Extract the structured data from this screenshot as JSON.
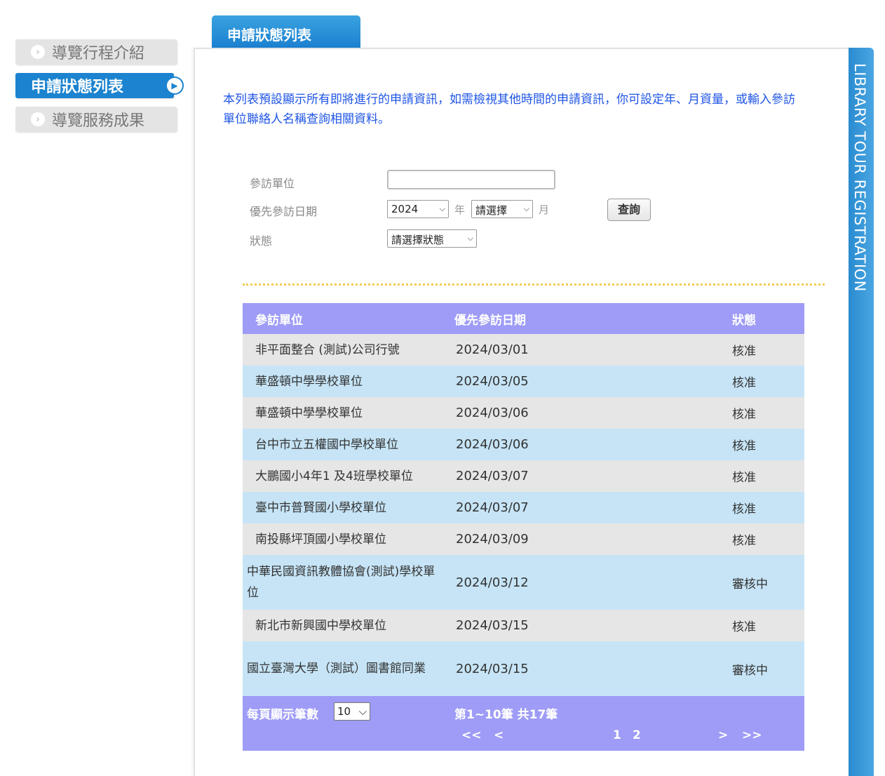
{
  "sidebar": {
    "items": [
      {
        "label": "導覽行程介紹",
        "active": false
      },
      {
        "label": "申請狀態列表",
        "active": true
      },
      {
        "label": "導覽服務成果",
        "active": false
      }
    ]
  },
  "tab": {
    "label": "申請狀態列表"
  },
  "vertical_banner": "LIBRARY TOUR REGISTRATION",
  "intro_text": "本列表預設顯示所有即將進行的申請資訊，如需檢視其他時間的申請資訊，你可設定年、月資量，或輸入參訪單位聯絡人名稱查詢相關資料。",
  "filters": {
    "unit_label": "參訪單位",
    "unit_value": "",
    "date_label": "優先參訪日期",
    "year_value": "2024",
    "year_unit": "年",
    "month_value": "請選擇",
    "month_unit": "月",
    "status_label": "狀態",
    "status_value": "請選擇狀態",
    "search_button": "查詢"
  },
  "table": {
    "headers": [
      "參訪單位",
      "優先參訪日期",
      "狀態"
    ],
    "rows": [
      {
        "unit": "非平面整合 (測試)公司行號",
        "date": "2024/03/01",
        "status": "核准"
      },
      {
        "unit": "華盛頓中學學校單位",
        "date": "2024/03/05",
        "status": "核准"
      },
      {
        "unit": "華盛頓中學學校單位",
        "date": "2024/03/06",
        "status": "核准"
      },
      {
        "unit": "台中市立五權國中學校單位",
        "date": "2024/03/06",
        "status": "核准"
      },
      {
        "unit": "大鵬國小4年1 及4班學校單位",
        "date": "2024/03/07",
        "status": "核准"
      },
      {
        "unit": "臺中市普賢國小學校單位",
        "date": "2024/03/07",
        "status": "核准"
      },
      {
        "unit": "南投縣坪頂國小學校單位",
        "date": "2024/03/09",
        "status": "核准"
      },
      {
        "unit": "中華民國資訊教體協會(測試)學校單位",
        "date": "2024/03/12",
        "status": "審核中"
      },
      {
        "unit": "新北市新興國中學校單位",
        "date": "2024/03/15",
        "status": "核准"
      },
      {
        "unit": "國立臺灣大學（測試）圖書館同業",
        "date": "2024/03/15",
        "status": "審核中"
      }
    ],
    "footer": {
      "per_page_label": "每頁顯示筆數",
      "per_page_value": "10",
      "range_text": "第1~10筆 共17筆",
      "first": "<<",
      "prev": "<",
      "page1": "1",
      "page2": "2",
      "next": ">",
      "last": ">>"
    }
  },
  "colors": {
    "accent_blue": "#1b83cf",
    "table_header": "#9e9cf6",
    "row_odd": "#e6e6e6",
    "row_even": "#c6e4f6",
    "intro_text": "#1f55e6"
  }
}
